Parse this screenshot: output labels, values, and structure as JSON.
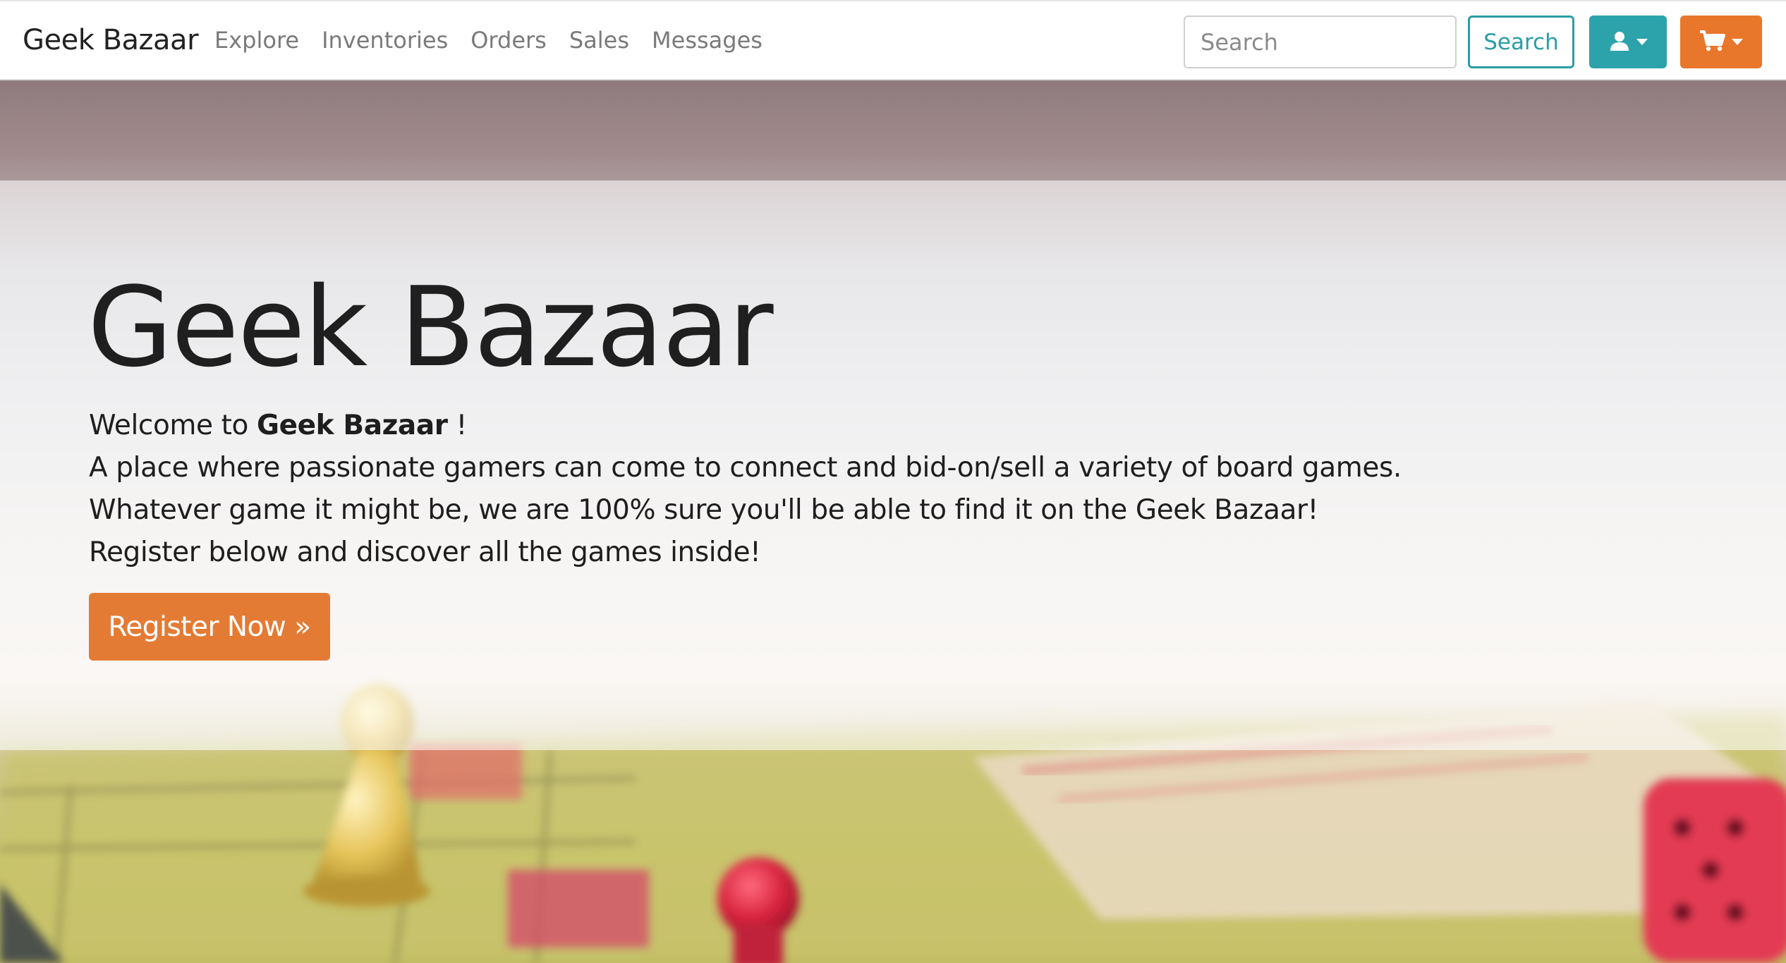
{
  "navbar": {
    "brand": "Geek Bazaar",
    "links": [
      "Explore",
      "Inventories",
      "Orders",
      "Sales",
      "Messages"
    ],
    "search_placeholder": "Search",
    "search_button": "Search",
    "user_icon": "user-icon",
    "cart_icon": "cart-icon"
  },
  "hero": {
    "title": "Geek Bazaar",
    "welcome_prefix": "Welcome to ",
    "welcome_brand": "Geek Bazaar",
    "welcome_suffix": " !",
    "line2": "A place where passionate gamers can come to connect and bid-on/sell a variety of board games.",
    "line3": "Whatever game it might be, we are 100% sure you'll be able to find it on the Geek Bazaar!",
    "line4": "Register below and discover all the games inside!",
    "register_button": "Register Now »"
  },
  "colors": {
    "accent_teal": "#2ca3ab",
    "accent_orange": "#e8762b",
    "register_orange": "#e47b34"
  }
}
